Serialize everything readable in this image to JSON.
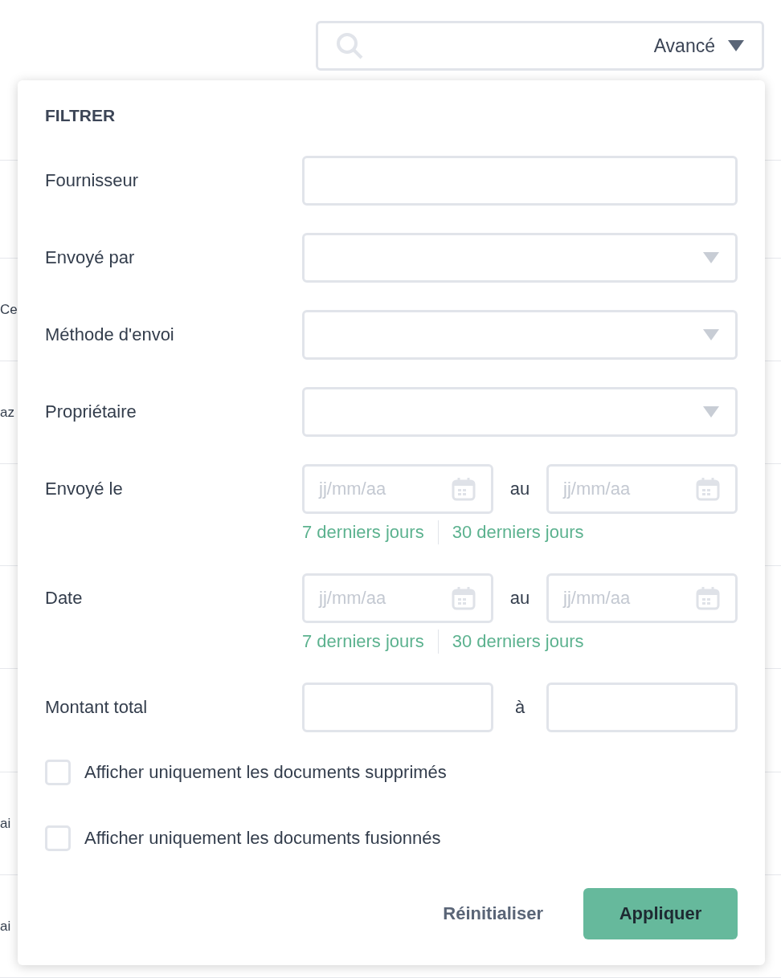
{
  "background_rows": [
    "Ce",
    "az",
    "ai",
    "ai"
  ],
  "search": {
    "advanced_label": "Avancé"
  },
  "filter_panel": {
    "title": "FILTRER",
    "fields": [
      {
        "kind": "text",
        "label": "Fournisseur"
      },
      {
        "kind": "select",
        "label": "Envoyé par"
      },
      {
        "kind": "select",
        "label": "Méthode d'envoi"
      },
      {
        "kind": "select",
        "label": "Propriétaire"
      },
      {
        "kind": "daterange",
        "label": "Envoyé le",
        "from_placeholder": "jj/mm/aa",
        "separator": "au",
        "to_placeholder": "jj/mm/aa",
        "shortcuts": [
          "7 derniers jours",
          "30 derniers jours"
        ]
      },
      {
        "kind": "daterange",
        "label": "Date",
        "from_placeholder": "jj/mm/aa",
        "separator": "au",
        "to_placeholder": "jj/mm/aa",
        "shortcuts": [
          "7 derniers jours",
          "30 derniers jours"
        ]
      },
      {
        "kind": "range",
        "label": "Montant total",
        "separator": "à"
      }
    ],
    "checkboxes": [
      {
        "label": "Afficher uniquement les documents supprimés",
        "checked": false
      },
      {
        "label": "Afficher uniquement les documents fusionnés",
        "checked": false
      }
    ],
    "buttons": [
      {
        "kind": "secondary",
        "label": "Réinitialiser"
      },
      {
        "kind": "primary",
        "label": "Appliquer"
      }
    ]
  }
}
